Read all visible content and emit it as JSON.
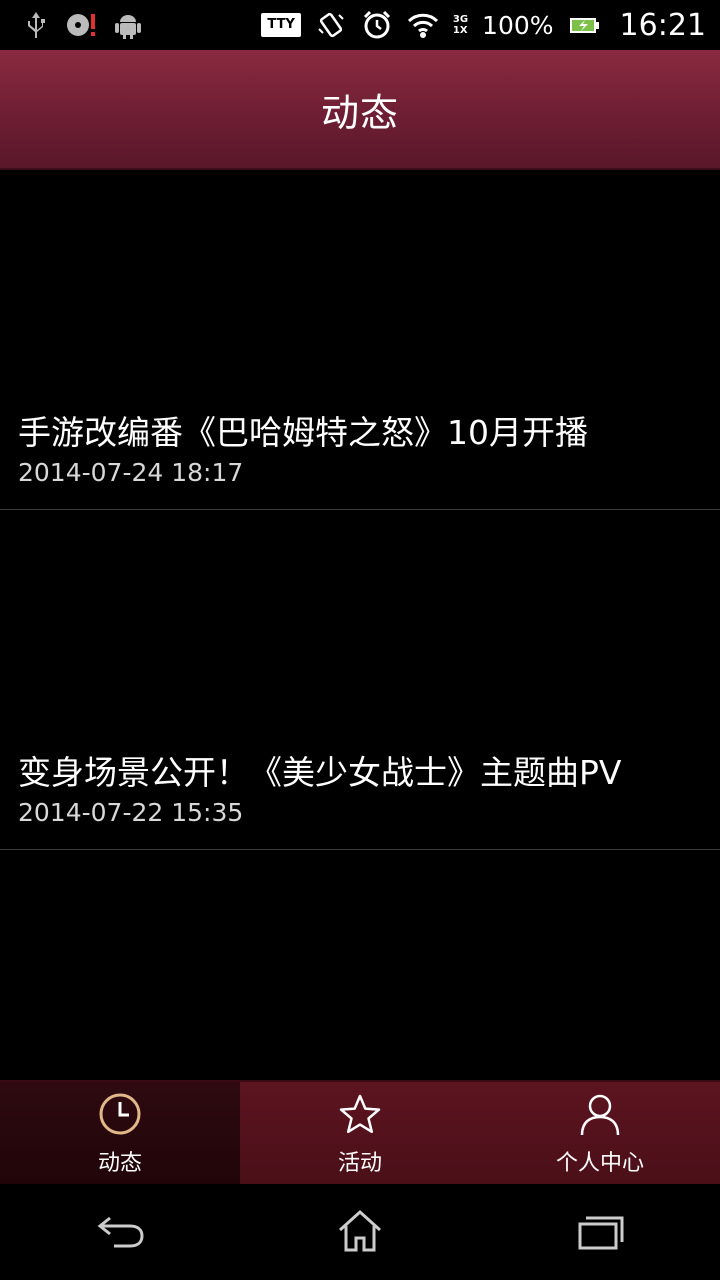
{
  "status_bar": {
    "tty": "TTY",
    "net_top": "3G",
    "net_bottom": "1X",
    "battery": "100%",
    "time": "16:21",
    "icons": [
      "usb-icon",
      "sd-card-alert-icon",
      "android-icon",
      "tty-icon",
      "vibrate-icon",
      "alarm-icon",
      "wifi-icon",
      "signal-icon",
      "battery-charging-icon"
    ]
  },
  "header": {
    "title": "动态"
  },
  "news": [
    {
      "headline": "手游改编番《巴哈姆特之怒》10月开播",
      "date": "2014-07-24 18:17"
    },
    {
      "headline": "变身场景公开！《美少女战士》主题曲PV",
      "date": "2014-07-22 15:35"
    }
  ],
  "tabs": [
    {
      "label": "动态",
      "icon": "clock-icon",
      "active": true
    },
    {
      "label": "活动",
      "icon": "star-icon",
      "active": false
    },
    {
      "label": "个人中心",
      "icon": "person-icon",
      "active": false
    }
  ],
  "nav": {
    "icons": [
      "back-icon",
      "home-icon",
      "recent-apps-icon"
    ]
  },
  "colors": {
    "header": "#6e1e33",
    "tab_bg": "#4a0f18",
    "tab_active": "#200508",
    "clock_accent": "#e0b88a"
  }
}
